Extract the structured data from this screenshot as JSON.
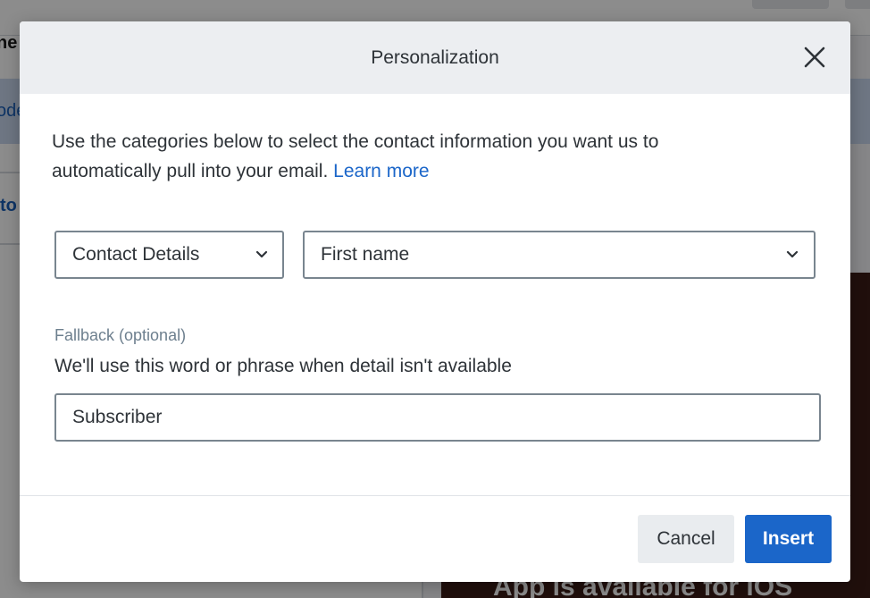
{
  "background": {
    "topbar_text": "ne",
    "band_text": "ode",
    "row_text": "to",
    "photo_text": "App is available for iOS"
  },
  "modal": {
    "title": "Personalization",
    "intro_text": "Use the categories below to select the contact information you want us to automatically pull into your email.",
    "learn_more": "Learn more",
    "category_select": {
      "value": "Contact Details"
    },
    "field_select": {
      "value": "First name"
    },
    "fallback": {
      "label": "Fallback (optional)",
      "help": "We'll use this word or phrase when detail isn't available",
      "value": "Subscriber"
    },
    "buttons": {
      "cancel": "Cancel",
      "insert": "Insert"
    }
  },
  "icons": {
    "close": "close-icon",
    "chevron": "chevron-down-icon"
  },
  "colors": {
    "accent": "#1b66c9",
    "header_bg": "#eceef1",
    "text": "#2e3338",
    "muted": "#6d7f8e",
    "border": "#79858f"
  }
}
